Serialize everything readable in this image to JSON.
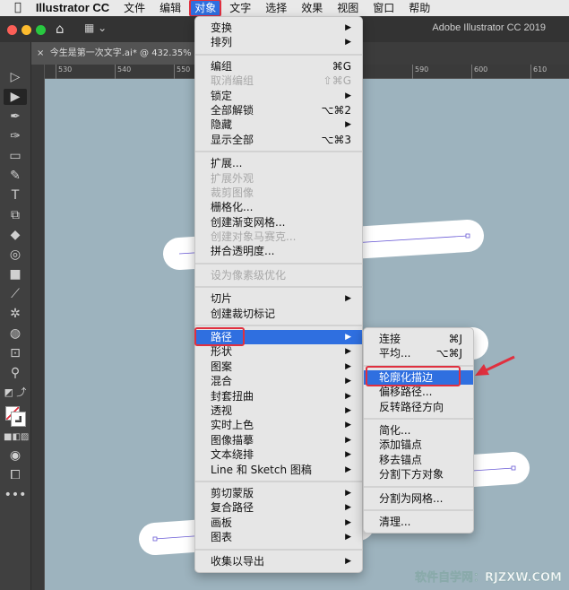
{
  "menubar": {
    "apple": "",
    "app": "Illustrator CC",
    "items": [
      "文件",
      "编辑",
      "对象",
      "文字",
      "选择",
      "效果",
      "视图",
      "窗口",
      "帮助"
    ],
    "active": "对象"
  },
  "titlebar": {
    "title": "Adobe Illustrator CC 2019"
  },
  "document_tab": {
    "close": "×",
    "title": "今生是第一次文字.ai* @ 432.35% (RG"
  },
  "ruler": {
    "labels": [
      "530",
      "540",
      "550",
      "590",
      "600",
      "610"
    ]
  },
  "object_menu": [
    {
      "label": "变换",
      "submenu": true
    },
    {
      "label": "排列",
      "submenu": true
    },
    {
      "sep": true
    },
    {
      "label": "编组",
      "shortcut": "⌘G"
    },
    {
      "label": "取消编组",
      "shortcut": "⇧⌘G",
      "disabled": true
    },
    {
      "label": "锁定",
      "submenu": true
    },
    {
      "label": "全部解锁",
      "shortcut": "⌥⌘2"
    },
    {
      "label": "隐藏",
      "submenu": true
    },
    {
      "label": "显示全部",
      "shortcut": "⌥⌘3"
    },
    {
      "sep": true
    },
    {
      "label": "扩展..."
    },
    {
      "label": "扩展外观",
      "disabled": true
    },
    {
      "label": "裁剪图像",
      "disabled": true
    },
    {
      "label": "栅格化..."
    },
    {
      "label": "创建渐变网格..."
    },
    {
      "label": "创建对象马赛克...",
      "disabled": true
    },
    {
      "label": "拼合透明度..."
    },
    {
      "sep": true
    },
    {
      "label": "设为像素级优化",
      "disabled": true
    },
    {
      "sep": true
    },
    {
      "label": "切片",
      "submenu": true
    },
    {
      "label": "创建裁切标记"
    },
    {
      "sep": true
    },
    {
      "label": "路径",
      "submenu": true,
      "highlighted": true
    },
    {
      "label": "形状",
      "submenu": true
    },
    {
      "label": "图案",
      "submenu": true
    },
    {
      "label": "混合",
      "submenu": true
    },
    {
      "label": "封套扭曲",
      "submenu": true
    },
    {
      "label": "透视",
      "submenu": true
    },
    {
      "label": "实时上色",
      "submenu": true
    },
    {
      "label": "图像描摹",
      "submenu": true
    },
    {
      "label": "文本绕排",
      "submenu": true
    },
    {
      "label": "Line 和 Sketch 图稿",
      "submenu": true
    },
    {
      "sep": true
    },
    {
      "label": "剪切蒙版",
      "submenu": true
    },
    {
      "label": "复合路径",
      "submenu": true
    },
    {
      "label": "画板",
      "submenu": true
    },
    {
      "label": "图表",
      "submenu": true
    },
    {
      "sep": true
    },
    {
      "label": "收集以导出",
      "submenu": true
    }
  ],
  "path_submenu": [
    {
      "label": "连接",
      "shortcut": "⌘J"
    },
    {
      "label": "平均...",
      "shortcut": "⌥⌘J"
    },
    {
      "sep": true
    },
    {
      "label": "轮廓化描边",
      "highlighted": true
    },
    {
      "label": "偏移路径..."
    },
    {
      "label": "反转路径方向"
    },
    {
      "sep": true
    },
    {
      "label": "简化..."
    },
    {
      "label": "添加锚点"
    },
    {
      "label": "移去锚点"
    },
    {
      "label": "分割下方对象"
    },
    {
      "sep": true
    },
    {
      "label": "分割为网格..."
    },
    {
      "sep": true
    },
    {
      "label": "清理..."
    }
  ],
  "tools": [
    "direct-selection",
    "selection",
    "pen",
    "curvature",
    "rectangle",
    "paintbrush",
    "type",
    "scale",
    "eraser",
    "shape-builder",
    "gradient",
    "eyedropper",
    "puppet-warp",
    "live-paint",
    "artboard",
    "zoom"
  ],
  "colors": {
    "accent": "#2f6fe0",
    "annotation": "#e0303f",
    "canvas": "#9db3be"
  },
  "watermark": "软件自学网：RJZXW.COM"
}
